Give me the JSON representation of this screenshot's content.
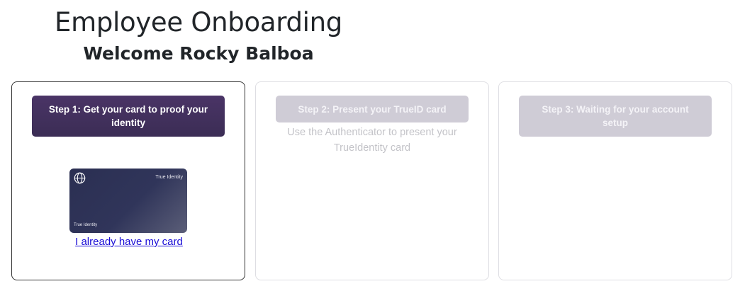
{
  "header": {
    "title": "Employee Onboarding",
    "subtitle": "Welcome Rocky Balboa"
  },
  "steps": [
    {
      "label": "Step 1: Get your card to proof your identity",
      "state": "active",
      "card_image": {
        "brand_top": "True Identity",
        "brand_bottom": "True Identity",
        "icon": "globe-icon"
      },
      "link": "I already have my card"
    },
    {
      "label": "Step 2: Present your TrueID card",
      "state": "inactive",
      "description": "Use the Authenticator to present your TrueIdentity card"
    },
    {
      "label": "Step 3: Waiting for your account setup",
      "state": "inactive"
    }
  ],
  "colors": {
    "active_step": "#3f2f5c",
    "inactive_step": "#cfccd6",
    "link": "#1a0dd6"
  }
}
